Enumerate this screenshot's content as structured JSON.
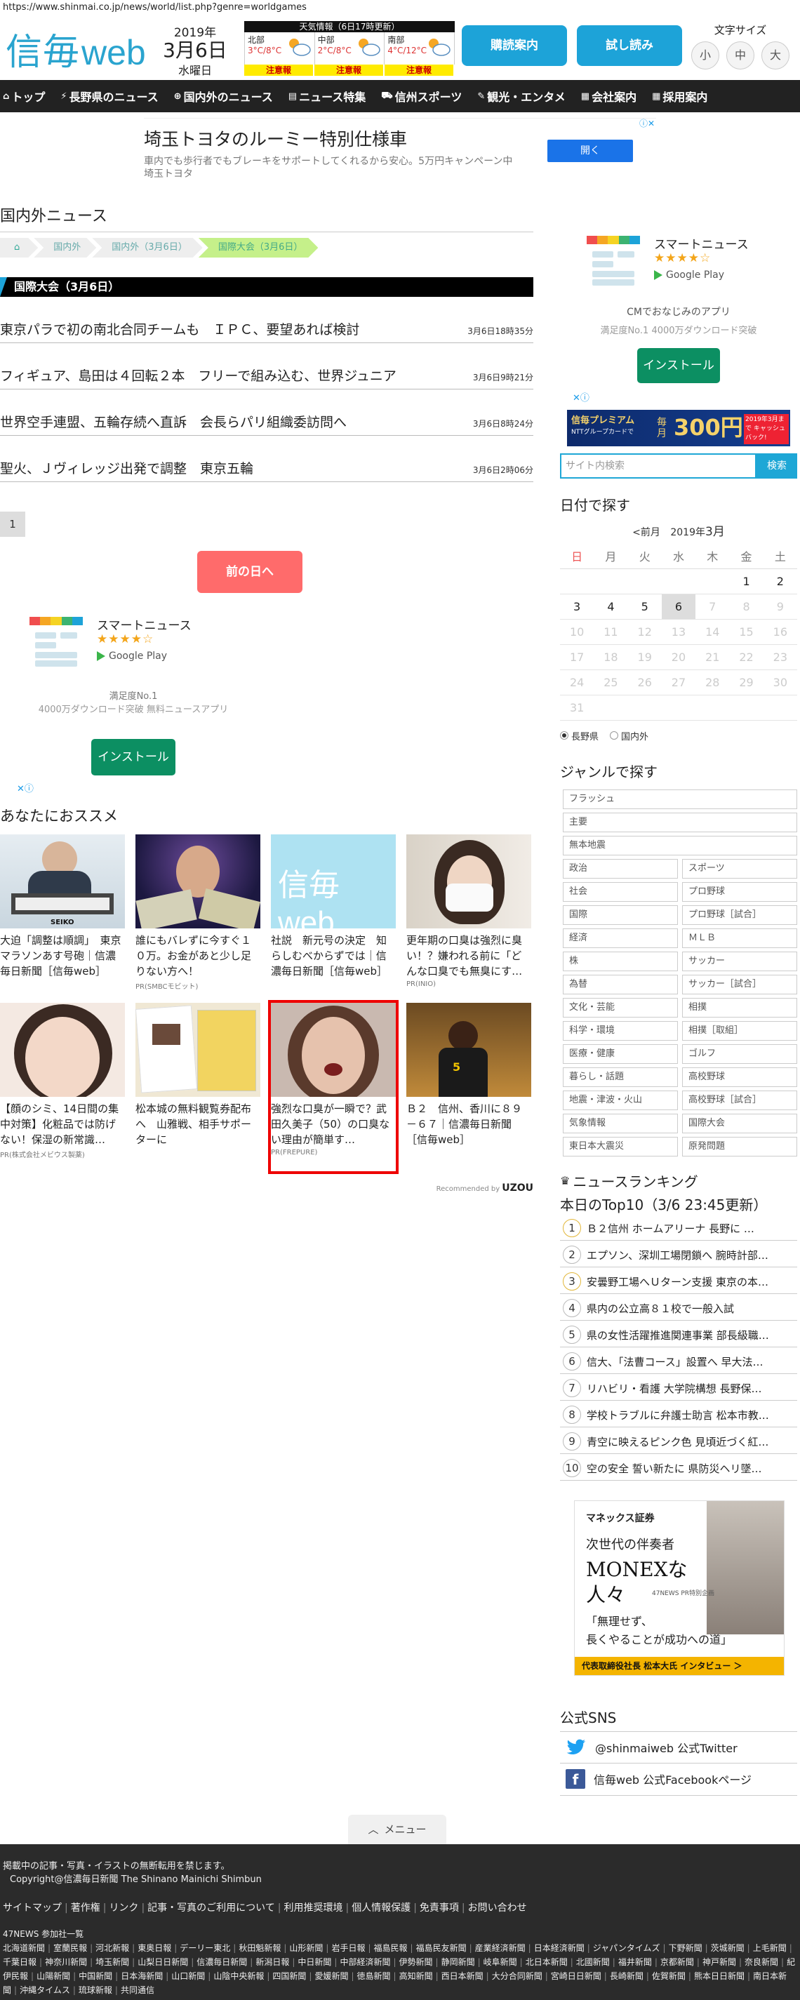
{
  "url": "https://www.shinmai.co.jp/news/world/list.php?genre=worldgames",
  "header": {
    "logo_jp": "信毎",
    "logo_web": "web",
    "year": "2019年",
    "month_day": "3月6日",
    "weekday": "水曜日",
    "weather_title": "天気情報（6日17時更新）",
    "weather": [
      {
        "area": "北部",
        "temp": "3°C/8°C",
        "warn": "注意報"
      },
      {
        "area": "中部",
        "temp": "2°C/8°C",
        "warn": "注意報"
      },
      {
        "area": "南部",
        "temp": "4°C/12°C",
        "warn": "注意報"
      }
    ],
    "subscribe_label": "購読案内",
    "trial_label": "試し読み",
    "fontsize_title": "文字サイズ",
    "fontsize_small": "小",
    "fontsize_medium": "中",
    "fontsize_large": "大"
  },
  "nav": [
    {
      "icon": "house-icon",
      "label": "トップ"
    },
    {
      "icon": "bolt-icon",
      "label": "長野県のニュース"
    },
    {
      "icon": "globe-icon",
      "label": "国内外のニュース"
    },
    {
      "icon": "document-icon",
      "label": "ニュース特集"
    },
    {
      "icon": "car-icon",
      "label": "信州スポーツ"
    },
    {
      "icon": "pen-icon",
      "label": "観光・エンタメ"
    },
    {
      "icon": "building-icon",
      "label": "会社案内"
    },
    {
      "icon": "building-icon",
      "label": "採用案内"
    }
  ],
  "banner_ad": {
    "title": "埼玉トヨタのルーミー特別仕様車",
    "desc": "車内でも歩行者でもブレーキをサポートしてくれるから安心。5万円キャンペーン中 埼玉トヨタ",
    "button": "開く"
  },
  "main": {
    "section_title": "国内外ニュース",
    "breadcrumbs": [
      "国内外",
      "国内外（3月6日）",
      "国際大会（3月6日）"
    ],
    "category": "国際大会（3月6日）",
    "articles": [
      {
        "title": "東京パラで初の南北合同チームも　ＩＰＣ、要望あれば検討",
        "date": "3月6日18時35分"
      },
      {
        "title": "フィギュア、島田は４回転２本　フリーで組み込む、世界ジュニア",
        "date": "3月6日9時21分"
      },
      {
        "title": "世界空手連盟、五輪存続へ直訴　会長らパリ組織委訪問へ",
        "date": "3月6日8時24分"
      },
      {
        "title": "聖火、Ｊヴィレッジ出発で調整　東京五輪",
        "date": "3月6日2時06分"
      }
    ],
    "page": "1",
    "prev_day": "前の日へ",
    "app_ad": {
      "name": "スマートニュース",
      "stars": "★★★★☆",
      "store": "Google Play",
      "line1": "満足度No.1",
      "line2": "4000万ダウンロード突破 無料ニュースアプリ",
      "install": "インストール"
    },
    "rec_title": "あなたにおススメ",
    "recs": [
      {
        "text": "大迫「調整は順調」　東京マラソンあす号砲｜信濃毎日新聞［信毎web］",
        "pr": ""
      },
      {
        "text": "誰にもバレずに今すぐ１０万。お金があと少し足りない方へ！",
        "pr": "PR(SMBCモビット)"
      },
      {
        "text": "社説　新元号の決定　知らしむべからずでは｜信濃毎日新聞［信毎web］",
        "pr": ""
      },
      {
        "text": "更年期の口臭は強烈に臭い！？嫌われる前に「どんな口臭でも無臭にす…",
        "pr": "PR(INIO)"
      },
      {
        "text": "【顔のシミ、14日間の集中対策】化粧品では防げない！保湿の新常識…",
        "pr": "PR(株式会社メビウス製薬)"
      },
      {
        "text": "松本城の無料観覧券配布へ　山雅戦、相手サポーターに",
        "pr": ""
      },
      {
        "text": "強烈な口臭が一瞬で？武田久美子（50）の口臭ない理由が簡単す…",
        "pr": "PR(FREPURE)"
      },
      {
        "text": "Ｂ２　信州、香川に８９－６７｜信濃毎日新聞［信毎web］",
        "pr": ""
      }
    ],
    "recommended_by": "Recommended by",
    "uzou": "UZOU"
  },
  "side": {
    "app_ad": {
      "name": "スマートニュース",
      "stars": "★★★★☆",
      "store": "Google Play",
      "caption": "CMでおなじみのアプリ",
      "sub": "満足度No.1 4000万ダウンロード突破",
      "install": "インストール"
    },
    "premium": {
      "brand": "信毎プレミアム",
      "sub": "NTTグループカードで",
      "every": "毎月",
      "amount": "300円",
      "note": "2019年3月まで キャッシュバック!"
    },
    "search_placeholder": "サイト内検索",
    "search_button": "検索",
    "date_title": "日付で探す",
    "cal_prev": "<前月",
    "cal_year": "2019年",
    "cal_month": "3月",
    "weekdays": [
      "日",
      "月",
      "火",
      "水",
      "木",
      "金",
      "土"
    ],
    "calendar": [
      [
        "",
        "",
        "",
        "",
        "",
        "1",
        "2"
      ],
      [
        "3",
        "4",
        "5",
        "6",
        "7",
        "8",
        "9"
      ],
      [
        "10",
        "11",
        "12",
        "13",
        "14",
        "15",
        "16"
      ],
      [
        "17",
        "18",
        "19",
        "20",
        "21",
        "22",
        "23"
      ],
      [
        "24",
        "25",
        "26",
        "27",
        "28",
        "29",
        "30"
      ],
      [
        "31",
        "",
        "",
        "",
        "",
        "",
        ""
      ]
    ],
    "radio_local": "長野県",
    "radio_world": "国内外",
    "genre_title": "ジャンルで探す",
    "genres_full": [
      "フラッシュ",
      "主要",
      "無本地震"
    ],
    "genres": [
      "政治",
      "スポーツ",
      "社会",
      "プロ野球",
      "国際",
      "プロ野球［試合］",
      "経済",
      "ＭＬＢ",
      "株",
      "サッカー",
      "為替",
      "サッカー［試合］",
      "文化・芸能",
      "相撲",
      "科学・環境",
      "相撲［取組］",
      "医療・健康",
      "ゴルフ",
      "暮らし・話題",
      "高校野球",
      "地震・津波・火山",
      "高校野球［試合］",
      "気象情報",
      "国際大会",
      "東日本大震災",
      "原発問題"
    ],
    "ranking_title": "ニュースランキング",
    "ranking_sub": "本日のTop10（3/6 23:45更新）",
    "ranking": [
      "Ｂ２信州 ホームアリーナ 長野に …",
      "エプソン、深圳工場閉鎖へ 腕時計部…",
      "安曇野工場へＵターン支援 東京の本…",
      "県内の公立高８１校で一般入試",
      "県の女性活躍推進関連事業 部長級職…",
      "信大、「法曹コース」設置へ 早大法…",
      "リハビリ・看護 大学院構想 長野保…",
      "学校トラブルに弁護士助言 松本市教…",
      "青空に映えるピンク色 見頃近づく紅…",
      "空の安全 誓い新たに 県防災ヘリ墜…"
    ],
    "monex": {
      "brand": "マネックス証券",
      "l1": "次世代の伴奏者",
      "l2": "MONEXな",
      "l3": "人々",
      "pr": "47NEWS PR特別企画",
      "q1": "「無理せず、",
      "q2": "長くやることが成功への道」",
      "foot": "代表取締役社長 松本大氏 インタビュー ＞"
    },
    "sns_title": "公式SNS",
    "twitter": "@shinmaiweb 公式Twitter",
    "facebook": "信毎web 公式Facebookページ"
  },
  "footer": {
    "menu": "メニュー",
    "notice": "掲載中の記事・写真・イラストの無断転用を禁じます。",
    "copyright": "Copyright@信濃毎日新聞 The Shinano Mainichi Shimbun",
    "links": [
      "サイトマップ",
      "著作権",
      "リンク",
      "記事・写真のご利用について",
      "利用推奨環境",
      "個人情報保護",
      "免責事項",
      "お問い合わせ"
    ],
    "papers_title": "47NEWS 参加社一覧",
    "papers": [
      "北海道新聞",
      "室蘭民報",
      "河北新報",
      "東奥日報",
      "デーリー東北",
      "秋田魁新報",
      "山形新聞",
      "岩手日報",
      "福島民報",
      "福島民友新聞",
      "産業経済新聞",
      "日本経済新聞",
      "ジャパンタイムズ",
      "下野新聞",
      "茨城新聞",
      "上毛新聞",
      "千葉日報",
      "神奈川新聞",
      "埼玉新聞",
      "山梨日日新聞",
      "信濃毎日新聞",
      "新潟日報",
      "中日新聞",
      "中部経済新聞",
      "伊勢新聞",
      "静岡新聞",
      "岐阜新聞",
      "北日本新聞",
      "北國新聞",
      "福井新聞",
      "京都新聞",
      "神戸新聞",
      "奈良新聞",
      "紀伊民報",
      "山陽新聞",
      "中国新聞",
      "日本海新聞",
      "山口新聞",
      "山陰中央新報",
      "四国新聞",
      "愛媛新聞",
      "徳島新聞",
      "高知新聞",
      "西日本新聞",
      "大分合同新聞",
      "宮崎日日新聞",
      "長崎新聞",
      "佐賀新聞",
      "熊本日日新聞",
      "南日本新聞",
      "沖縄タイムス",
      "琉球新報",
      "共同通信"
    ]
  }
}
